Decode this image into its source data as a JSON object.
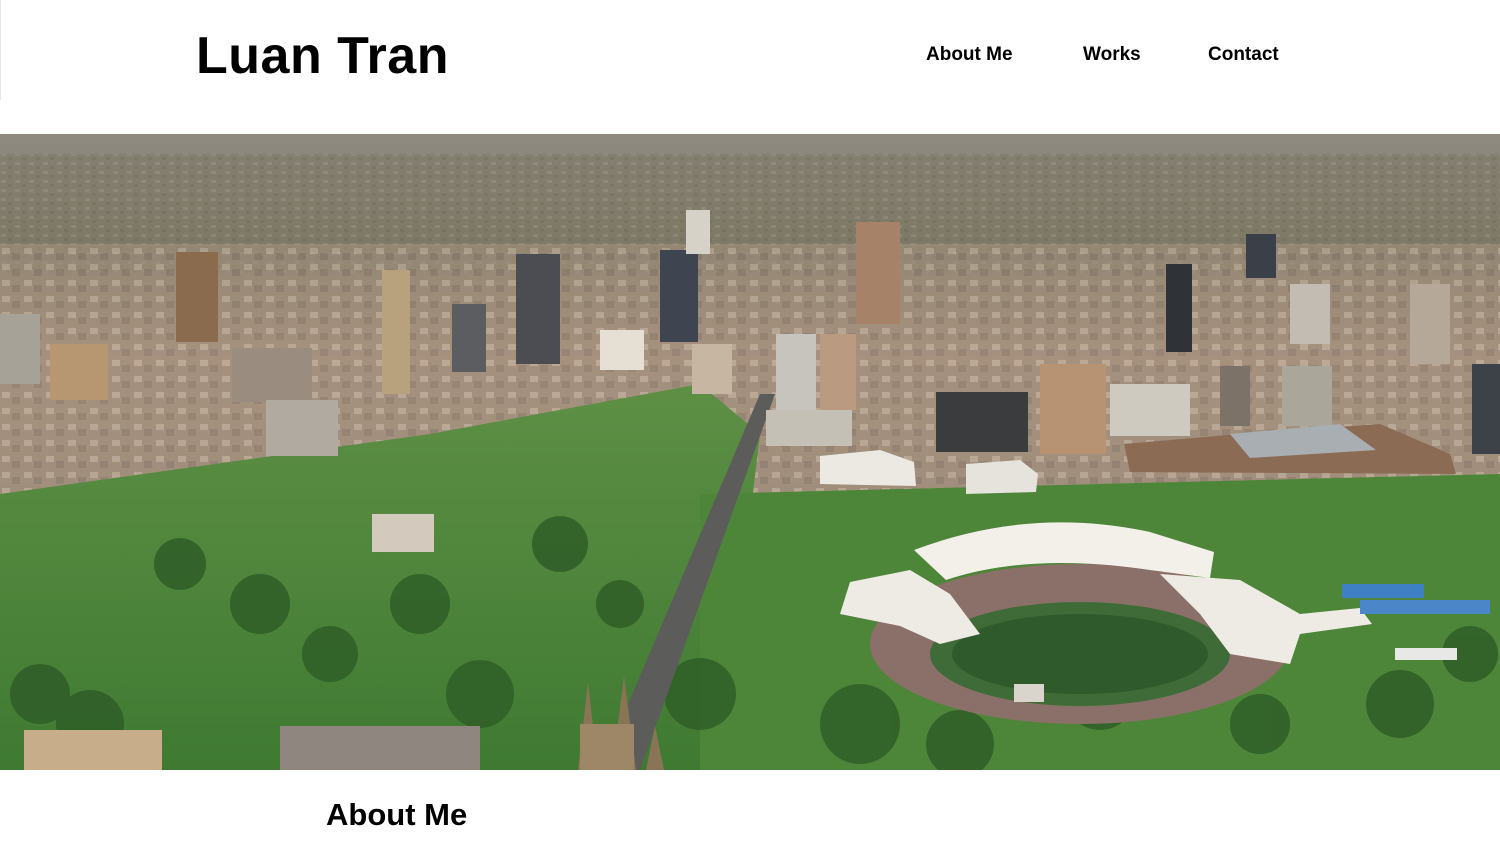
{
  "site": {
    "title": "Luan Tran"
  },
  "nav": {
    "items": [
      {
        "label": "About Me"
      },
      {
        "label": "Works"
      },
      {
        "label": "Contact"
      }
    ]
  },
  "hero": {
    "image_subject": "aerial city skyline with stadium",
    "colors": {
      "sky_haze": "#9a8f83",
      "city": "#b49a86",
      "park": "#4f8a3a",
      "stadium_roof": "#f2efe9"
    }
  },
  "main": {
    "section_title": "About Me"
  }
}
